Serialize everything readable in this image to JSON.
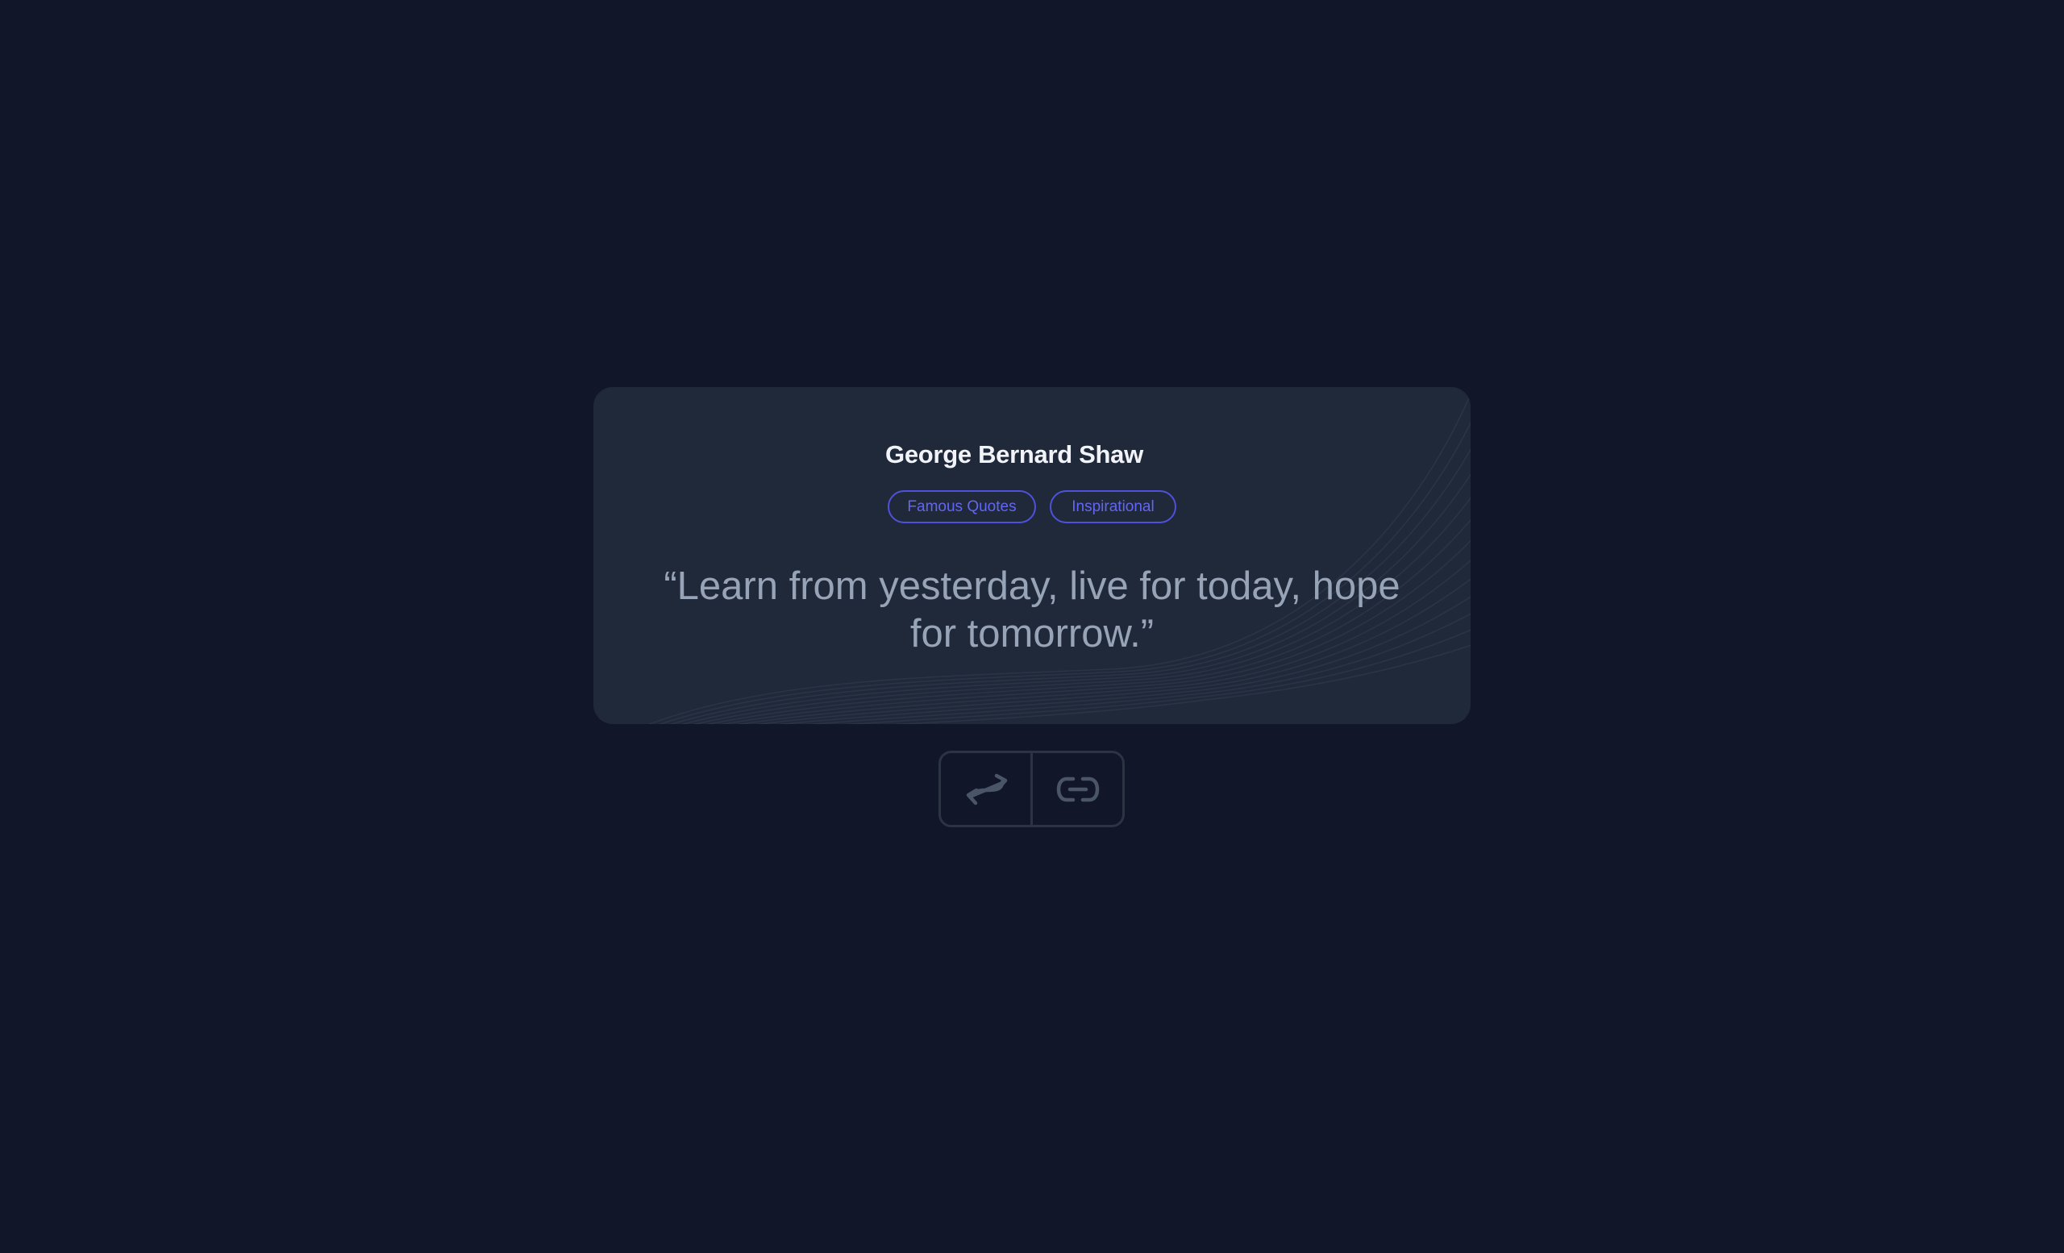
{
  "card": {
    "author": "George Bernard Shaw",
    "tags": [
      "Famous Quotes",
      "Inspirational"
    ],
    "quote": "“Learn from yesterday, live for today, hope for tomorrow.”"
  },
  "actions": {
    "shuffle_icon": "shuffle-arrows-icon",
    "link_icon": "link-icon"
  },
  "colors": {
    "background": "#111729",
    "card": "#20293a",
    "tag_border": "#4f52d9",
    "tag_text": "#6366f1",
    "quote_text": "#97a3b6",
    "author_text": "#f1f3f8",
    "button_border": "#2c3444"
  }
}
